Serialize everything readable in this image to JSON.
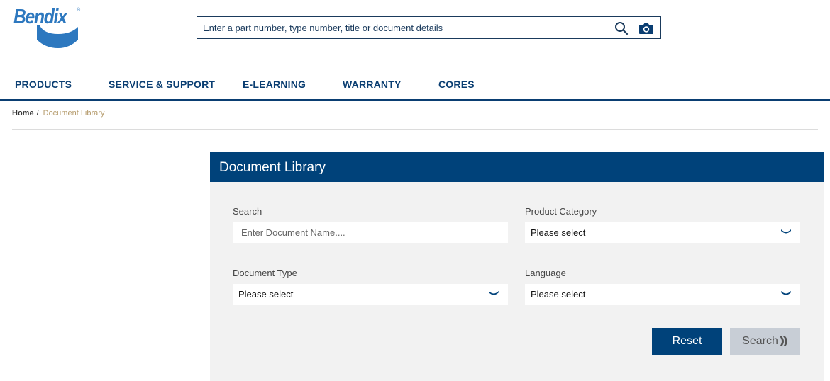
{
  "brand": {
    "name": "Bendix",
    "registered": "®"
  },
  "header_search": {
    "placeholder": "Enter a part number, type number, title or document details",
    "search_icon": "search-icon",
    "camera_icon": "camera-icon"
  },
  "nav": {
    "items": [
      {
        "label": "PRODUCTS"
      },
      {
        "label": "SERVICE & SUPPORT"
      },
      {
        "label": "E-LEARNING"
      },
      {
        "label": "WARRANTY"
      },
      {
        "label": "CORES"
      }
    ]
  },
  "breadcrumb": {
    "home": "Home",
    "separator": "/",
    "current": "Document Library"
  },
  "panel": {
    "title": "Document Library",
    "search": {
      "label": "Search",
      "placeholder": "Enter Document Name...."
    },
    "product_category": {
      "label": "Product Category",
      "value": "Please select"
    },
    "document_type": {
      "label": "Document Type",
      "value": "Please select"
    },
    "language": {
      "label": "Language",
      "value": "Please select"
    },
    "reset_label": "Reset",
    "search_label": "Search"
  },
  "colors": {
    "primary": "#00427a",
    "nav_text": "#0a3e72",
    "logo": "#2d78bf",
    "breadcrumb_current": "#b49a6a",
    "panel_bg": "#f2f2f2",
    "disabled_button": "#c8ced6"
  }
}
